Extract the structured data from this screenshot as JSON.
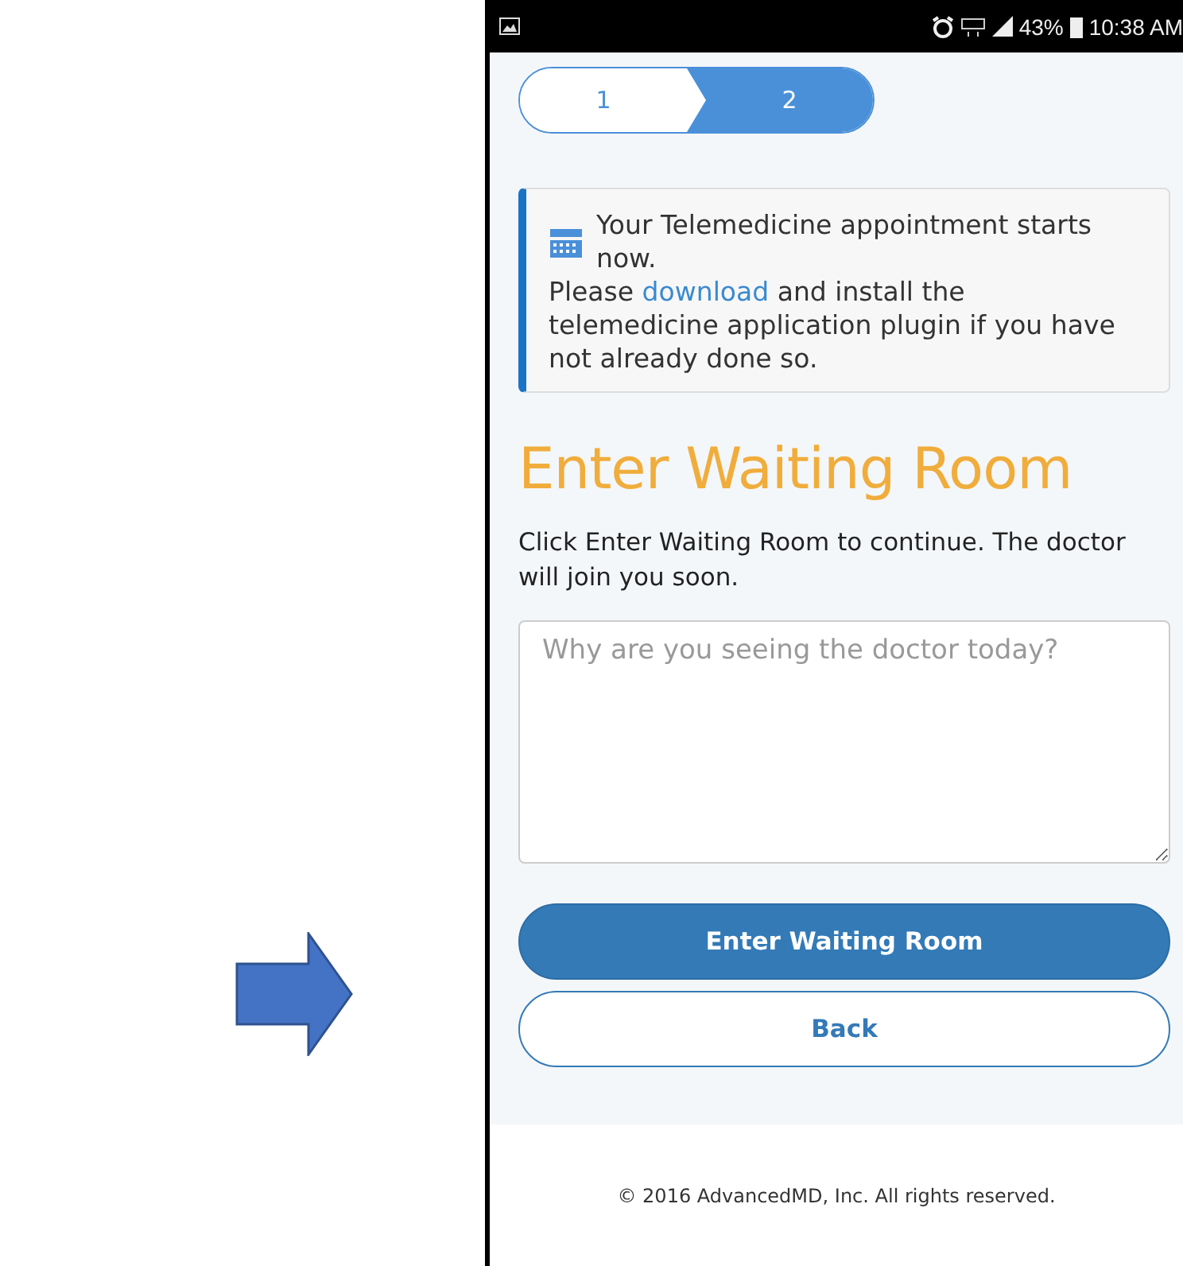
{
  "status_bar": {
    "battery": "43%",
    "time": "10:38 AM"
  },
  "steps": [
    {
      "label": "1",
      "selected": false
    },
    {
      "label": "2",
      "selected": true
    }
  ],
  "notice": {
    "title": "Your Telemedicine appointment starts now.",
    "body_before": "Please ",
    "link": "download",
    "body_after": " and install the telemedicine application plugin if you have not already done so."
  },
  "heading": "Enter Waiting Room",
  "intro": "Click Enter Waiting Room to continue. The doctor will join you soon.",
  "reason_field": {
    "placeholder": "Why are you seeing the doctor today?"
  },
  "buttons": [
    {
      "label": "Enter Waiting Room",
      "kind": "primary"
    },
    {
      "label": "Back",
      "kind": "secondary"
    }
  ],
  "footer": "© 2016 AdvancedMD, Inc. All rights reserved."
}
